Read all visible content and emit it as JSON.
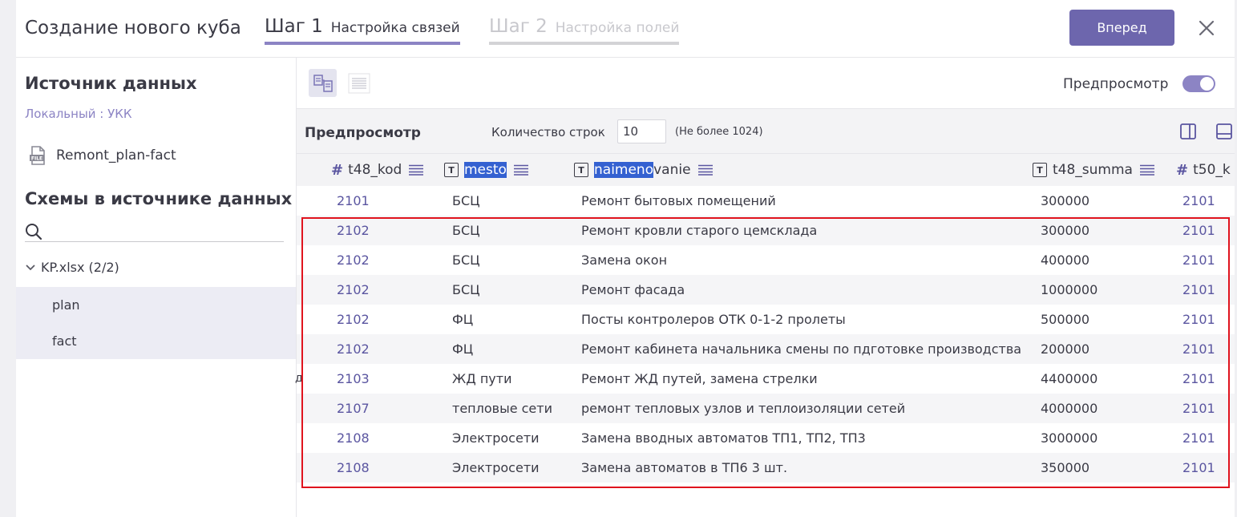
{
  "header": {
    "title": "Создание нового куба",
    "steps": [
      {
        "num": "Шаг 1",
        "label": "Настройка связей"
      },
      {
        "num": "Шаг 2",
        "label": "Настройка полей"
      }
    ],
    "next_label": "Вперед"
  },
  "sidebar": {
    "source_heading": "Источник данных",
    "source_sub": "Локальный : УКК",
    "file_name": "Remont_plan-fact",
    "schemas_heading": "Схемы в источнике данных",
    "tree_root": "KP.xlsx (2/2)",
    "tree_items": [
      "plan",
      "fact"
    ]
  },
  "toolbar": {
    "preview_label": "Предпросмотр"
  },
  "preview": {
    "title": "Предпросмотр",
    "rows_label": "Количество строк",
    "rows_value": "10",
    "rows_hint": "(Не более 1024)"
  },
  "table": {
    "columns": [
      {
        "type": "number",
        "name": "t48_kod"
      },
      {
        "type": "text",
        "name": "mesto",
        "highlight": "mesto",
        "rest": ""
      },
      {
        "type": "text",
        "name": "naimenovanie",
        "highlight": "naimeno",
        "rest": "vanie"
      },
      {
        "type": "text",
        "name": "t48_summa"
      },
      {
        "type": "number",
        "name": "t50_k"
      }
    ],
    "rows": [
      [
        "2101",
        "БСЦ",
        "Ремонт бытовых помещений",
        "300000",
        "2101"
      ],
      [
        "2102",
        "БСЦ",
        "Ремонт кровли старого цемсклада",
        "300000",
        "2101"
      ],
      [
        "2102",
        "БСЦ",
        "Замена окон",
        "400000",
        "2101"
      ],
      [
        "2102",
        "БСЦ",
        "Ремонт фасада",
        "1000000",
        "2101"
      ],
      [
        "2102",
        "ФЦ",
        "Посты контролеров ОТК 0-1-2 пролеты",
        "500000",
        "2101"
      ],
      [
        "2102",
        "ФЦ",
        "Ремонт кабинета начальника смены по пдготовке производства",
        "200000",
        "2101"
      ],
      [
        "2103",
        "ЖД пути",
        "Ремонт ЖД путей, замена стрелки",
        "4400000",
        "2101"
      ],
      [
        "2107",
        "тепловые сети",
        "ремонт тепловых узлов и теплоизоляции сетей",
        "4000000",
        "2101"
      ],
      [
        "2108",
        "Электросети",
        "Замена вводных автоматов ТП1, ТП2, ТП3",
        "3000000",
        "2101"
      ],
      [
        "2108",
        "Электросети",
        "Замена автоматов в ТП6 3 шт.",
        "350000",
        "2101"
      ]
    ]
  },
  "edge_char": "д",
  "colors": {
    "accent": "#6d66ad",
    "accent_light": "#8c84c4",
    "number_text": "#5a55a0",
    "highlight": "#3461d1",
    "selection_border": "#e0141e"
  }
}
